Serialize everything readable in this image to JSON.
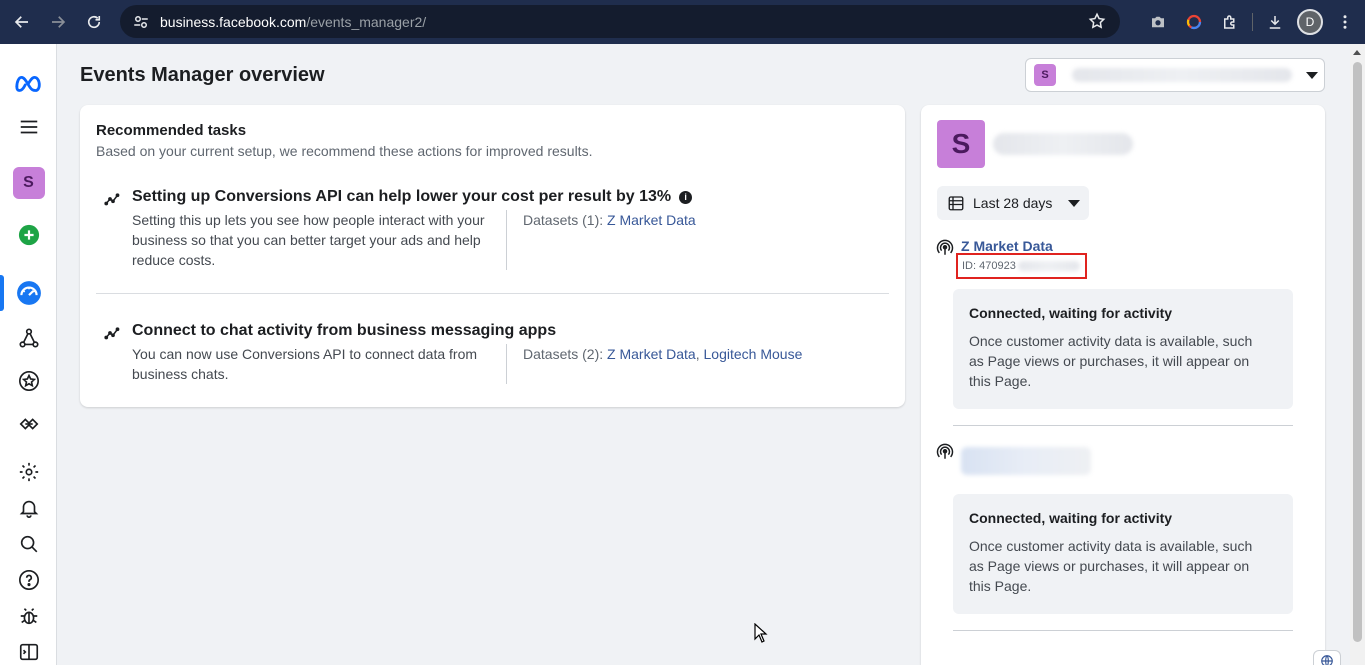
{
  "browser": {
    "url_host": "business.facebook.com",
    "url_path": "/events_manager2/",
    "profile_initial": "D"
  },
  "sidebar": {
    "account_initial": "S",
    "items": [
      {
        "icon": "meta-logo-icon"
      },
      {
        "icon": "menu-icon"
      },
      {
        "icon": "account-avatar"
      },
      {
        "icon": "create-icon"
      },
      {
        "icon": "events-manager-icon"
      },
      {
        "icon": "data-sources-icon"
      },
      {
        "icon": "star-icon"
      },
      {
        "icon": "partner-integrations-icon"
      },
      {
        "icon": "settings-icon"
      },
      {
        "icon": "notifications-icon"
      },
      {
        "icon": "search-icon"
      },
      {
        "icon": "help-icon"
      },
      {
        "icon": "debug-icon"
      },
      {
        "icon": "collapse-panel-icon"
      }
    ]
  },
  "main": {
    "title": "Events Manager overview",
    "account_selector_initial": "S",
    "recommended": {
      "title": "Recommended tasks",
      "subtitle": "Based on your current setup, we recommend these actions for improved results.",
      "tasks": [
        {
          "title": "Setting up Conversions API can help lower your cost per result by 13%",
          "description": "Setting this up lets you see how people interact with your business so that you can better target your ads and help reduce costs.",
          "datasets_label": "Datasets (1): ",
          "datasets": [
            "Z Market Data"
          ]
        },
        {
          "title": "Connect to chat activity from business messaging apps",
          "description": "You can now use Conversions API to connect data from business chats.",
          "datasets_label": "Datasets (2): ",
          "datasets": [
            "Z Market Data",
            "Logitech Mouse"
          ],
          "datasets_sep": ", "
        }
      ]
    }
  },
  "right_panel": {
    "account_initial": "S",
    "date_range": "Last 28 days",
    "datasets": [
      {
        "name": "Z Market Data",
        "id": "ID: 470923",
        "status_title": "Connected, waiting for activity",
        "status_body": "Once customer activity data is available, such as Page views or purchases, it will appear on this Page."
      },
      {
        "status_title": "Connected, waiting for activity",
        "status_body": "Once customer activity data is available, such as Page views or purchases, it will appear on this Page."
      }
    ]
  },
  "colors": {
    "link": "#385898",
    "accent": "#1877f2",
    "account_badge": "#c77fd9",
    "highlight_border": "#e0231f"
  }
}
